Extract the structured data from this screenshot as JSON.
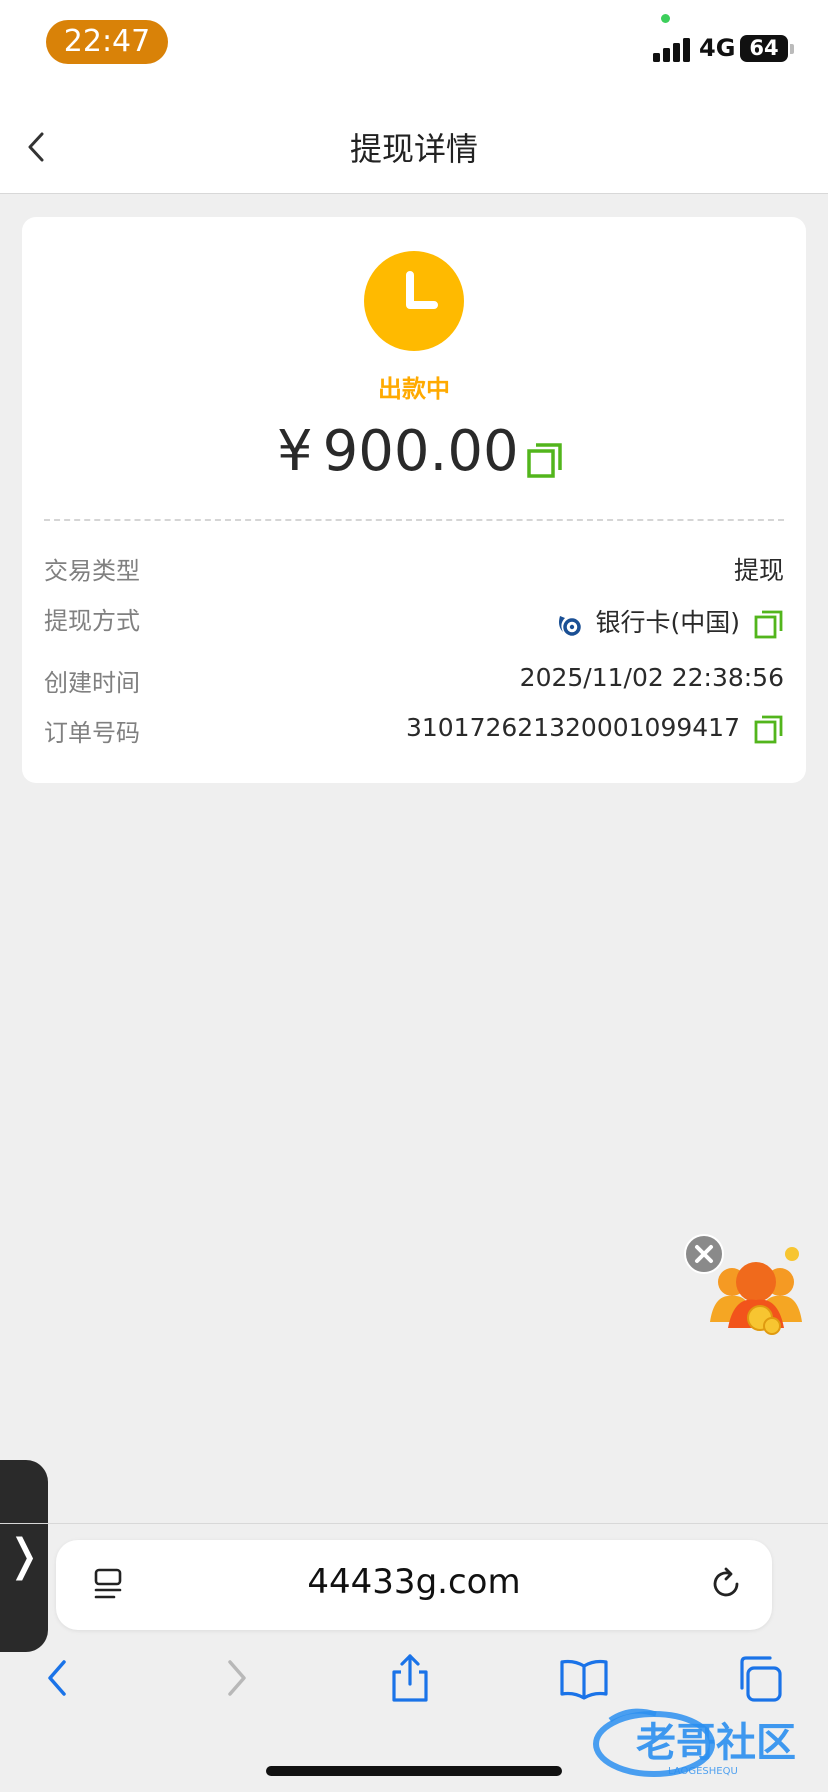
{
  "status_bar": {
    "time": "22:47",
    "network": "4G",
    "battery": "64"
  },
  "nav": {
    "title": "提现详情"
  },
  "card": {
    "status": "出款中",
    "amount_currency": "¥",
    "amount": "900.00",
    "rows": [
      {
        "label": "交易类型",
        "value": "提现"
      },
      {
        "label": "提现方式",
        "value": "银行卡(中国)"
      },
      {
        "label": "创建时间",
        "value": "2025/11/02 22:38:56"
      },
      {
        "label": "订单号码",
        "value": "310172621320001099417"
      }
    ]
  },
  "browser": {
    "url": "44433g.com"
  },
  "side_tab": {
    "glyph": "❭"
  },
  "colors": {
    "accent_orange": "#ffba00",
    "copy_green": "#52b51c",
    "time_pill": "#d98208",
    "browser_blue": "#1a73e8"
  }
}
